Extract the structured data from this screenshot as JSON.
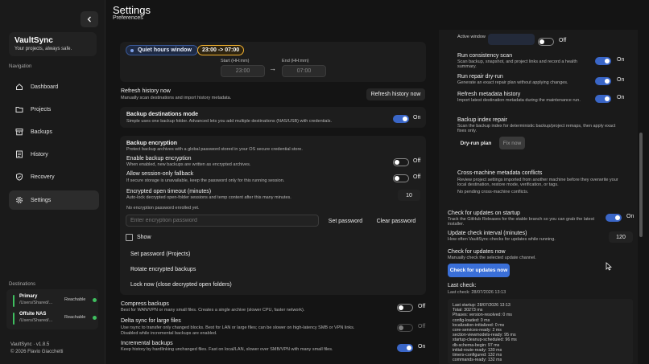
{
  "header": {
    "title": "Settings",
    "subtitle": "Preferences"
  },
  "sidebar": {
    "brand": {
      "name": "VaultSync",
      "tagline": "Your projects, always safe."
    },
    "nav_label": "Navigation",
    "items": [
      {
        "label": "Dashboard",
        "icon": "home-icon"
      },
      {
        "label": "Projects",
        "icon": "folder-icon"
      },
      {
        "label": "Backups",
        "icon": "archive-icon"
      },
      {
        "label": "History",
        "icon": "history-icon"
      },
      {
        "label": "Recovery",
        "icon": "shield-icon"
      },
      {
        "label": "Settings",
        "icon": "gear-icon"
      }
    ],
    "destinations_label": "Destinations",
    "destinations": [
      {
        "name": "Primary",
        "path": "/Users/Shared/...",
        "status": "Reachable"
      },
      {
        "name": "Offsite NAS",
        "path": "/Users/Shared/...",
        "status": "Reachable"
      }
    ],
    "version": "VaultSync · v1.8.5",
    "copyright": "© 2026 Flavio Giacchetti"
  },
  "left": {
    "quiet_hours": {
      "label": "Quiet hours window",
      "badge": "23:00 -> 07:00",
      "start_label": "Start (HH:mm)",
      "start_value": "23:00",
      "end_label": "End (HH:mm)",
      "end_value": "07:00",
      "arrow": "→"
    },
    "refresh_history": {
      "label": "Refresh history now",
      "desc": "Manually scan destinations and import history metadata.",
      "button": "Refresh history now"
    },
    "backup_mode": {
      "label": "Backup destinations mode",
      "desc": "Simple uses one backup folder. Advanced lets you add multiple destinations (NAS/USB) with credentials.",
      "state": "On"
    },
    "encryption": {
      "label": "Backup encryption",
      "desc": "Protect backup archives with a global password stored in your OS secure credential store.",
      "enable_label": "Enable backup encryption",
      "enable_desc": "When enabled, new backups are written as encrypted archives.",
      "enable_state": "Off",
      "session_label": "Allow session-only fallback",
      "session_desc": "If secure storage is unavailable, keep the password only for this running session.",
      "session_state": "Off",
      "timeout_label": "Encrypted open timeout (minutes)",
      "timeout_desc": "Auto-lock decrypted open-folder sessions and temp content after this many minutes.",
      "timeout_value": "10",
      "status_text": "No encryption password enrolled yet.",
      "password_placeholder": "Enter encryption password",
      "set_password": "Set password",
      "clear_password": "Clear password",
      "show_label": "Show",
      "actions": [
        "Set password (Projects)",
        "Rotate encrypted backups",
        "Lock now (close decrypted open folders)"
      ]
    },
    "compress": {
      "label": "Compress backups",
      "desc": "Best for WAN/VPN or many small files. Creates a single archive (slower CPU, faster network).",
      "state": "Off"
    },
    "delta_sync": {
      "label": "Delta sync for large files",
      "desc1": "Use rsync to transfer only changed blocks. Best for LAN or large files; can be slower on high-latency SMB or VPN links.",
      "desc2": "Disabled while incremental backups are enabled.",
      "state": "Off"
    },
    "incremental": {
      "label": "Incremental backups",
      "desc": "Keep history by hardlinking unchanged files. Fast on local/LAN, slower over SMB/VPN with many small files.",
      "state": "On"
    }
  },
  "right": {
    "active_window": {
      "label": "Active window",
      "state": "Off"
    },
    "consistency": {
      "label": "Run consistency scan",
      "desc1": "Scan backup, snapshot, and project links and record a health",
      "desc2": "summary.",
      "state": "On"
    },
    "repair": {
      "label": "Run repair dry-run",
      "desc": "Generate an exact repair plan without applying changes.",
      "state": "On"
    },
    "refresh_meta": {
      "label": "Refresh metadata history",
      "desc": "Import latest destination metadata during the maintenance run.",
      "state": "On"
    },
    "index_repair": {
      "label": "Backup index repair",
      "desc1": "Scan the backup index for deterministic backup/project remaps, then apply exact",
      "desc2": "fixes only.",
      "dry_run": "Dry-run plan",
      "fix_now": "Fix now"
    },
    "conflicts": {
      "label": "Cross-machine metadata conflicts",
      "desc1": "Review project settings imported from another machine before they overwrite your",
      "desc2": "local destination, restore mode, verification, or tags.",
      "status": "No pending cross-machine conflicts."
    },
    "updates_startup": {
      "label": "Check for updates on startup",
      "desc1": "Track the GitHub Releases for the stable branch so you can grab the latest",
      "desc2": "installer.",
      "state": "On"
    },
    "update_interval": {
      "label": "Update check interval (minutes)",
      "desc": "How often VaultSync checks for updates while running.",
      "value": "120"
    },
    "check_now": {
      "label": "Check for updates now",
      "desc": "Manually check the selected update channel.",
      "button": "Check for updates now"
    },
    "last_check": {
      "label": "Last check:",
      "value": "Last check: 28/07/2026 13:13"
    },
    "log": [
      "Last startup: 28/07/2026 13:13",
      "Total: 30273 ms",
      "Phases: version-resolved: 0 ms",
      "config-loaded: 0 ms",
      "localization-initialized: 0 ms",
      "core-services-ready: 2 ms",
      "section-viewmodels-ready: 95 ms",
      "startup-cleanup-scheduled: 96 ms",
      "db-schema-begin: 97 ms",
      "initial-route-ready: 130 ms",
      "timers-configured: 132 ms",
      "commands-ready: 132 ms"
    ]
  },
  "colors": {
    "accent": "#3a66c7",
    "reachable": "#3fbf5f",
    "badge": "#f0b030",
    "background": "#141414"
  }
}
